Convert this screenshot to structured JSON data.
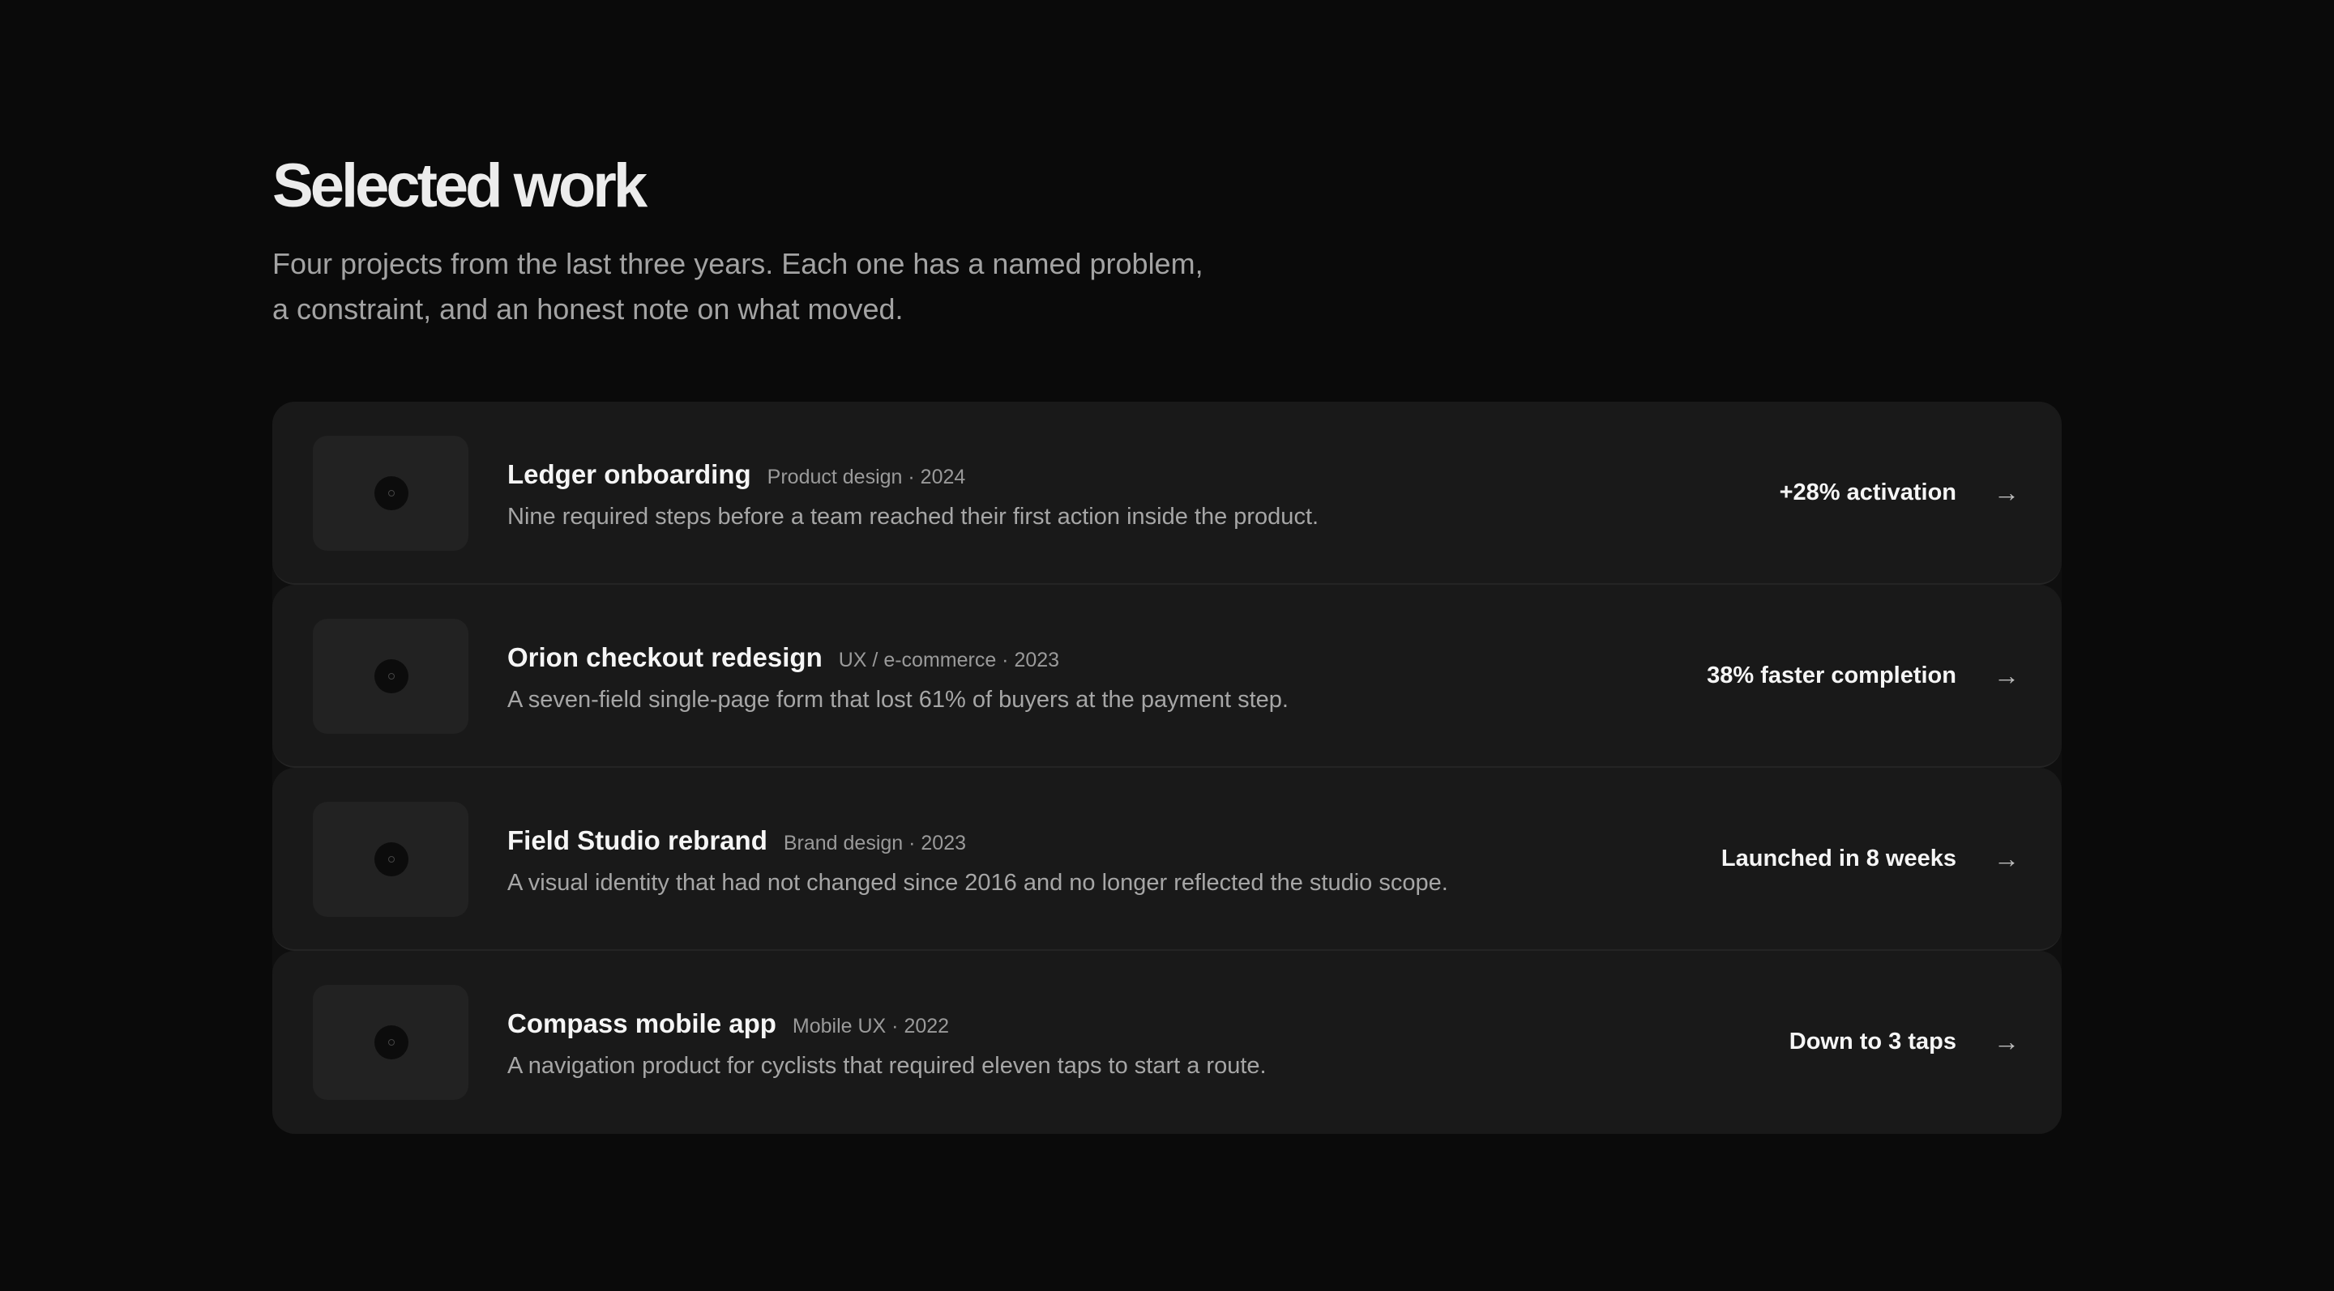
{
  "heading": "Selected work",
  "intro": "Four projects from the last three years. Each one has a named problem, a constraint, and an honest note on what moved.",
  "projects": [
    {
      "title": "Ledger onboarding",
      "meta": "Product design · 2024",
      "description": "Nine required steps before a team reached their first action inside the product.",
      "result": "+28% activation",
      "arrow": "→",
      "thumbnail_icon": "image-placeholder-icon"
    },
    {
      "title": "Orion checkout redesign",
      "meta": "UX / e-commerce · 2023",
      "description": "A seven-field single-page form that lost 61% of buyers at the payment step.",
      "result": "38% faster completion",
      "arrow": "→",
      "thumbnail_icon": "image-placeholder-icon"
    },
    {
      "title": "Field Studio rebrand",
      "meta": "Brand design · 2023",
      "description": "A visual identity that had not changed since 2016 and no longer reflected the studio scope.",
      "result": "Launched in 8 weeks",
      "arrow": "→",
      "thumbnail_icon": "image-placeholder-icon"
    },
    {
      "title": "Compass mobile app",
      "meta": "Mobile UX · 2022",
      "description": "A navigation product for cyclists that required eleven taps to start a route.",
      "result": "Down to 3 taps",
      "arrow": "→",
      "thumbnail_icon": "image-placeholder-icon"
    }
  ],
  "colors": {
    "background": "#0a0a0a",
    "card": "#191919",
    "thumbnail": "#222222",
    "text_primary": "#f5f5f5",
    "text_secondary": "#a6a6a6"
  }
}
